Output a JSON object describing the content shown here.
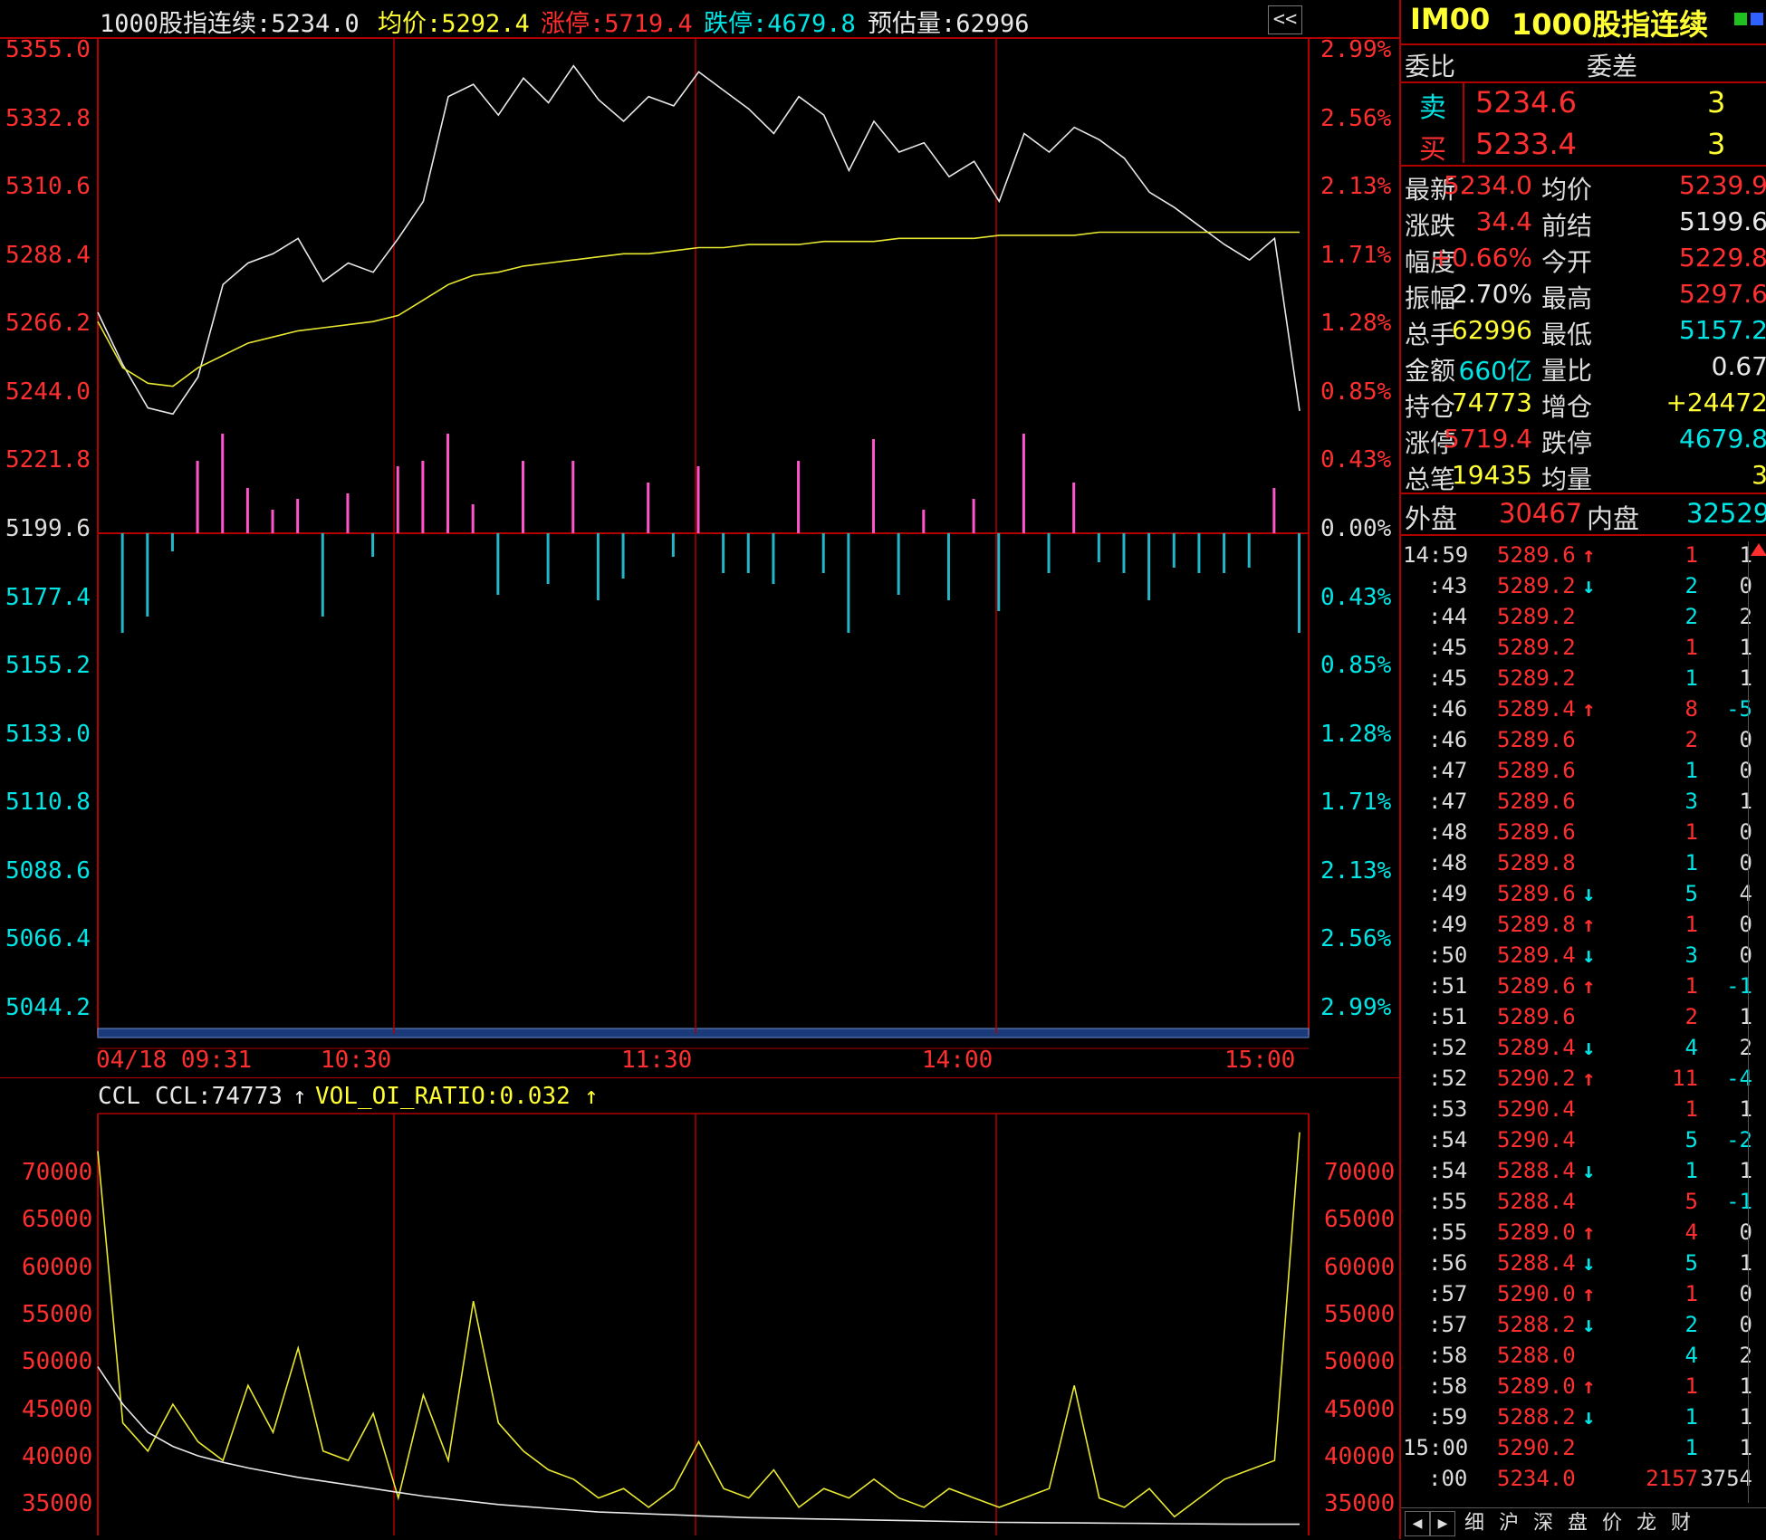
{
  "colors": {
    "red": "#ff2f2f",
    "cyan": "#00e5e5",
    "yellow": "#ffff33",
    "white": "#e8e8e8",
    "grid": "#b00000",
    "vol_up": "#ff55cc",
    "vol_dn": "#22b6c8"
  },
  "header": {
    "name": "1000股指连续:5234.0",
    "avg": "均价:5292.4",
    "limit_up": "涨停:5719.4",
    "limit_down": "跌停:4679.8",
    "est_vol": "预估量:62996",
    "collapse_btn": "<<"
  },
  "price_axis_left": [
    "5355.0",
    "5332.8",
    "5310.6",
    "5288.4",
    "5266.2",
    "5244.0",
    "5221.8",
    "5199.6",
    "5177.4",
    "5155.2",
    "5133.0",
    "5110.8",
    "5088.6",
    "5066.4",
    "5044.2"
  ],
  "pct_axis_right": [
    "2.99%",
    "2.56%",
    "2.13%",
    "1.71%",
    "1.28%",
    "0.85%",
    "0.43%",
    "0.00%",
    "0.43%",
    "0.85%",
    "1.28%",
    "1.71%",
    "2.13%",
    "2.56%",
    "2.99%"
  ],
  "time_axis": [
    "04/18 09:31",
    "10:30",
    "11:30",
    "14:00",
    "15:00"
  ],
  "indicator": {
    "name": "CCL",
    "ccl": "CCL:74773",
    "ccl_arrow": "↑",
    "ratio": "VOL_OI_RATIO:0.032",
    "ratio_arrow": "↑",
    "yaxis": [
      "70000",
      "65000",
      "60000",
      "55000",
      "50000",
      "45000",
      "40000",
      "35000"
    ]
  },
  "panel": {
    "code": "IM00",
    "title": "1000股指连续",
    "weibi_label": "委比",
    "weicha_label": "委差",
    "sell_label": "卖",
    "sell_price": "5234.6",
    "sell_vol": "3",
    "buy_label": "买",
    "buy_price": "5233.4",
    "buy_vol": "3",
    "stats": [
      {
        "l1": "最新",
        "v1": "5234.0",
        "c1": "red",
        "l2": "均价",
        "v2": "5239.9",
        "c2": "red"
      },
      {
        "l1": "涨跌",
        "v1": "34.4",
        "c1": "red",
        "l2": "前结",
        "v2": "5199.6",
        "c2": "white"
      },
      {
        "l1": "幅度",
        "v1": "+0.66%",
        "c1": "red",
        "l2": "今开",
        "v2": "5229.8",
        "c2": "red"
      },
      {
        "l1": "振幅",
        "v1": "2.70%",
        "c1": "white",
        "l2": "最高",
        "v2": "5297.6",
        "c2": "red"
      },
      {
        "l1": "总手",
        "v1": "62996",
        "c1": "yellow",
        "l2": "最低",
        "v2": "5157.2",
        "c2": "cyan"
      },
      {
        "l1": "金额",
        "v1": "660亿",
        "c1": "cyan",
        "l2": "量比",
        "v2": "0.67",
        "c2": "white"
      },
      {
        "l1": "持仓",
        "v1": "74773",
        "c1": "yellow",
        "l2": "增仓",
        "v2": "+24472",
        "c2": "yellow"
      },
      {
        "l1": "涨停",
        "v1": "5719.4",
        "c1": "red",
        "l2": "跌停",
        "v2": "4679.8",
        "c2": "cyan"
      },
      {
        "l1": "总笔",
        "v1": "19435",
        "c1": "yellow",
        "l2": "均量",
        "v2": "3",
        "c2": "yellow"
      }
    ],
    "outer_label": "外盘",
    "outer_val": "30467",
    "inner_label": "内盘",
    "inner_val": "32529",
    "ticks": [
      {
        "t": "14:59",
        "p": "5289.6",
        "a": "up",
        "v": "1",
        "d": "1"
      },
      {
        "t": ":43",
        "p": "5289.2",
        "a": "dn",
        "v": "2",
        "d": "0"
      },
      {
        "t": ":44",
        "p": "5289.2",
        "a": "",
        "v": "2",
        "d": "2"
      },
      {
        "t": ":45",
        "p": "5289.2",
        "a": "",
        "v": "1",
        "d": "1"
      },
      {
        "t": ":45",
        "p": "5289.2",
        "a": "",
        "v": "1",
        "d": "1"
      },
      {
        "t": ":46",
        "p": "5289.4",
        "a": "up",
        "v": "8",
        "d": "-5"
      },
      {
        "t": ":46",
        "p": "5289.6",
        "a": "",
        "v": "2",
        "d": "0"
      },
      {
        "t": ":47",
        "p": "5289.6",
        "a": "",
        "v": "1",
        "d": "0"
      },
      {
        "t": ":47",
        "p": "5289.6",
        "a": "",
        "v": "3",
        "d": "1"
      },
      {
        "t": ":48",
        "p": "5289.6",
        "a": "",
        "v": "1",
        "d": "0"
      },
      {
        "t": ":48",
        "p": "5289.8",
        "a": "",
        "v": "1",
        "d": "0"
      },
      {
        "t": ":49",
        "p": "5289.6",
        "a": "dn",
        "v": "5",
        "d": "4"
      },
      {
        "t": ":49",
        "p": "5289.8",
        "a": "up",
        "v": "1",
        "d": "0"
      },
      {
        "t": ":50",
        "p": "5289.4",
        "a": "dn",
        "v": "3",
        "d": "0"
      },
      {
        "t": ":51",
        "p": "5289.6",
        "a": "up",
        "v": "1",
        "d": "-1"
      },
      {
        "t": ":51",
        "p": "5289.6",
        "a": "",
        "v": "2",
        "d": "1"
      },
      {
        "t": ":52",
        "p": "5289.4",
        "a": "dn",
        "v": "4",
        "d": "2"
      },
      {
        "t": ":52",
        "p": "5290.2",
        "a": "up",
        "v": "11",
        "d": "-4"
      },
      {
        "t": ":53",
        "p": "5290.4",
        "a": "",
        "v": "1",
        "d": "1"
      },
      {
        "t": ":54",
        "p": "5290.4",
        "a": "",
        "v": "5",
        "d": "-2"
      },
      {
        "t": ":54",
        "p": "5288.4",
        "a": "dn",
        "v": "1",
        "d": "1"
      },
      {
        "t": ":55",
        "p": "5288.4",
        "a": "",
        "v": "5",
        "d": "-1"
      },
      {
        "t": ":55",
        "p": "5289.0",
        "a": "up",
        "v": "4",
        "d": "0"
      },
      {
        "t": ":56",
        "p": "5288.4",
        "a": "dn",
        "v": "5",
        "d": "1"
      },
      {
        "t": ":57",
        "p": "5290.0",
        "a": "up",
        "v": "1",
        "d": "0"
      },
      {
        "t": ":57",
        "p": "5288.2",
        "a": "dn",
        "v": "2",
        "d": "0"
      },
      {
        "t": ":58",
        "p": "5288.0",
        "a": "",
        "v": "4",
        "d": "2"
      },
      {
        "t": ":58",
        "p": "5289.0",
        "a": "up",
        "v": "1",
        "d": "1"
      },
      {
        "t": ":59",
        "p": "5288.2",
        "a": "dn",
        "v": "1",
        "d": "1"
      },
      {
        "t": "15:00",
        "p": "5290.2",
        "a": "",
        "v": "1",
        "d": "1"
      },
      {
        "t": ":00",
        "p": "5234.0",
        "a": "",
        "v": "2157",
        "d": "3754"
      }
    ],
    "bottom_tabs": [
      "细",
      "沪",
      "深",
      "盘",
      "价",
      "龙",
      "财"
    ]
  },
  "chart_data": [
    {
      "type": "line",
      "title": "1000股指连续",
      "x": [
        "09:31",
        "09:35",
        "09:40",
        "09:45",
        "09:50",
        "09:55",
        "10:00",
        "10:05",
        "10:10",
        "10:15",
        "10:20",
        "10:25",
        "10:30",
        "10:35",
        "10:40",
        "10:45",
        "10:50",
        "10:55",
        "11:00",
        "11:05",
        "11:10",
        "11:15",
        "11:20",
        "11:25",
        "11:30",
        "13:05",
        "13:10",
        "13:15",
        "13:20",
        "13:25",
        "13:30",
        "13:35",
        "13:40",
        "13:45",
        "13:50",
        "13:55",
        "14:00",
        "14:05",
        "14:10",
        "14:15",
        "14:20",
        "14:25",
        "14:30",
        "14:35",
        "14:40",
        "14:45",
        "14:50",
        "14:55",
        "15:00"
      ],
      "series": [
        {
          "name": "1000股指连续",
          "color": "white",
          "values": [
            5266,
            5249,
            5235,
            5233,
            5245,
            5275,
            5282,
            5285,
            5290,
            5276,
            5282,
            5279,
            5290,
            5302,
            5336,
            5340,
            5330,
            5342,
            5334,
            5346,
            5335,
            5328,
            5336,
            5333,
            5344,
            5338,
            5332,
            5324,
            5336,
            5330,
            5312,
            5328,
            5318,
            5321,
            5310,
            5315,
            5302,
            5324,
            5318,
            5326,
            5322,
            5316,
            5305,
            5300,
            5294,
            5288,
            5283,
            5290,
            5234
          ]
        },
        {
          "name": "均价",
          "color": "yellow",
          "values": [
            5263,
            5248,
            5243,
            5242,
            5248,
            5252,
            5256,
            5258,
            5260,
            5261,
            5262,
            5263,
            5265,
            5270,
            5275,
            5278,
            5279,
            5281,
            5282,
            5283,
            5284,
            5285,
            5285,
            5286,
            5287,
            5287,
            5288,
            5288,
            5288,
            5289,
            5289,
            5289,
            5290,
            5290,
            5290,
            5290,
            5291,
            5291,
            5291,
            5291,
            5292,
            5292,
            5292,
            5292,
            5292,
            5292,
            5292,
            5292,
            5292
          ]
        }
      ],
      "ylim": [
        5044.2,
        5355.0
      ]
    },
    {
      "type": "line",
      "title": "CCL",
      "x": [
        "09:31",
        "09:35",
        "09:40",
        "09:45",
        "09:50",
        "09:55",
        "10:00",
        "10:05",
        "10:10",
        "10:15",
        "10:20",
        "10:25",
        "10:30",
        "10:35",
        "10:40",
        "10:45",
        "10:50",
        "10:55",
        "11:00",
        "11:05",
        "11:10",
        "11:15",
        "11:20",
        "11:25",
        "11:30",
        "13:05",
        "13:10",
        "13:15",
        "13:20",
        "13:25",
        "13:30",
        "13:35",
        "13:40",
        "13:45",
        "13:50",
        "13:55",
        "14:00",
        "14:05",
        "14:10",
        "14:15",
        "14:20",
        "14:25",
        "14:30",
        "14:35",
        "14:40",
        "14:45",
        "14:50",
        "14:55",
        "15:00"
      ],
      "series": [
        {
          "name": "VOL_OI_RATIO",
          "color": "yellow",
          "values": [
            72000,
            43000,
            40000,
            45000,
            41000,
            39000,
            47000,
            42000,
            51000,
            40000,
            39000,
            44000,
            35000,
            46000,
            39000,
            56000,
            43000,
            40000,
            38000,
            37000,
            35000,
            36000,
            34000,
            36000,
            41000,
            36000,
            35000,
            38000,
            34000,
            36000,
            35000,
            37000,
            35000,
            34000,
            36000,
            35000,
            34000,
            35000,
            36000,
            47000,
            35000,
            34000,
            36000,
            33000,
            35000,
            37000,
            38000,
            39000,
            74000
          ]
        },
        {
          "name": "CCL",
          "color": "white",
          "values": [
            49000,
            45000,
            42000,
            40500,
            39500,
            38800,
            38200,
            37700,
            37200,
            36800,
            36400,
            36000,
            35600,
            35200,
            34900,
            34600,
            34300,
            34100,
            33900,
            33700,
            33500,
            33400,
            33300,
            33200,
            33100,
            33000,
            32900,
            32850,
            32800,
            32750,
            32700,
            32650,
            32600,
            32550,
            32500,
            32450,
            32400,
            32380,
            32360,
            32340,
            32320,
            32300,
            32280,
            32260,
            32240,
            32220,
            32200,
            32200,
            32200
          ]
        }
      ],
      "ylim": [
        31000,
        76000
      ]
    }
  ]
}
